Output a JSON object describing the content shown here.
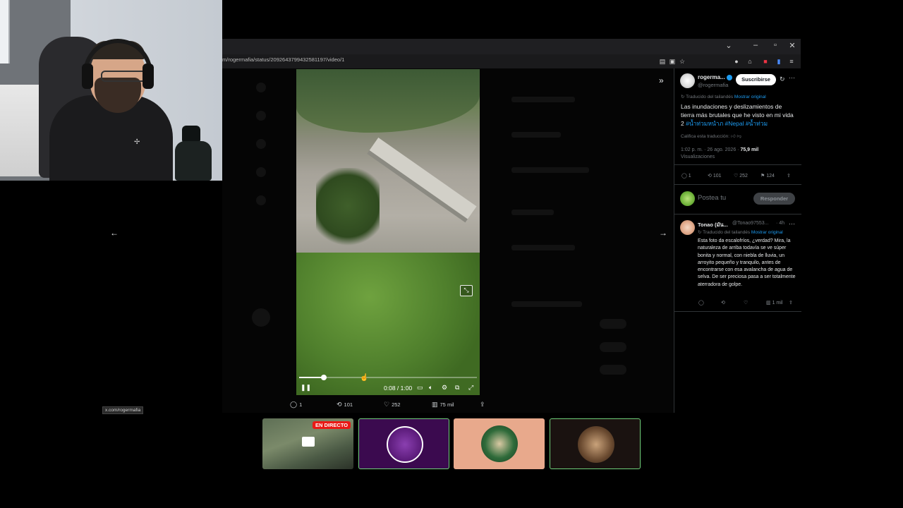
{
  "browser": {
    "url": "m/rogermafia/status/2092643799432581197/video/1",
    "status_bar_url": "x.com/rogermafia",
    "window_controls": [
      "chevron-down-icon",
      "minimize-icon",
      "restore-icon",
      "close-icon"
    ]
  },
  "video": {
    "time": "0:08 / 1:00",
    "progress": 0.14
  },
  "post_stats": {
    "replies": "1",
    "reposts": "101",
    "likes": "252",
    "views": "75 mil"
  },
  "tweet": {
    "author_name": "rogerma...",
    "author_handle": "@rogermafia",
    "subscribe_label": "Suscribirse",
    "translated_note": "Traducido del tailandés",
    "show_original": "Mostrar original",
    "text": "Las inundaciones y deslizamientos de tierra más brutales que he visto en mi vida 2 ",
    "hashtags": "#น้ำท่วมหนำภ #Nepal #น้ำท่วม",
    "rate_translation": "Califica esta traducción:",
    "timestamp": "1:02 p. m. · 26 ago. 2026 · ",
    "views_count": "75,9 mil",
    "views_label": "Visualizaciones",
    "replies": "1",
    "reposts": "101",
    "likes": "252",
    "bookmarks": "124"
  },
  "compose": {
    "placeholder": "Postea tu",
    "reply_button": "Responder"
  },
  "reply": {
    "author_name": "Tonao (มัน...",
    "author_handle": "@Tonao97553...",
    "time": "· 4h",
    "translated_note": "Traducido del tailandés",
    "show_original": "Mostrar original",
    "text": "Esta foto da escalofríos, ¿verdad? Mira, la naturaleza de arriba todavía se ve súper bonita y normal, con niebla de lluvia, un arroyito pequeño y tranquilo, antes de encontrarse con esa avalancha de agua de selva. De ser preciosa pasa a ser totalmente aterradora de golpe.",
    "views": "1 mil"
  },
  "stream": {
    "live_badge": "EN DIRECTO"
  },
  "colors": {
    "accent": "#1d9bf0",
    "live": "#e91916",
    "thumb_purple": "#3b0a4f",
    "thumb_peach": "#e8a98c",
    "thumb_border_green": "#6fcf7a"
  }
}
